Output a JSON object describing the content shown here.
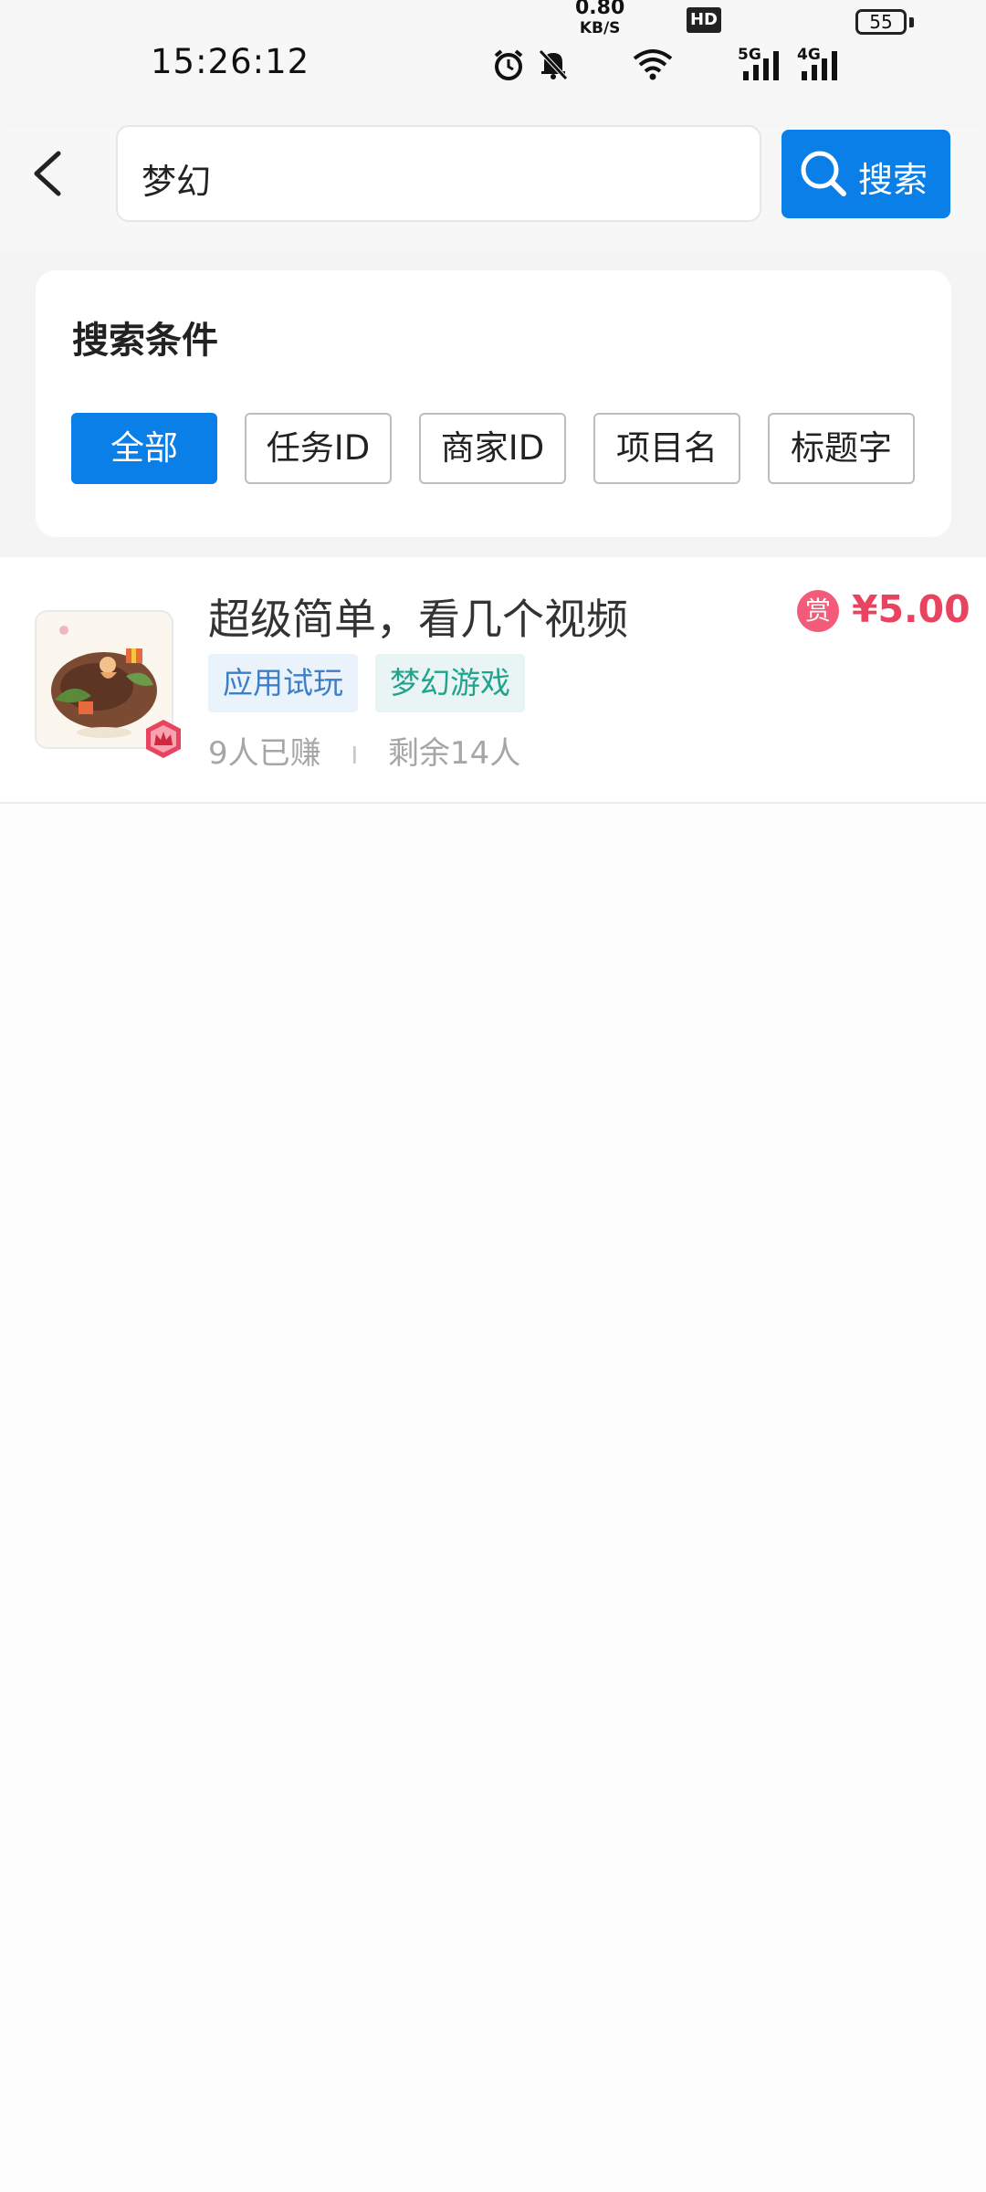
{
  "status_bar": {
    "time": "15:26:12",
    "net_speed_value": "0.80",
    "net_speed_unit": "KB/S",
    "hd_label": "HD",
    "signal1_label": "5G",
    "signal2_label": "4G",
    "battery": "55"
  },
  "header": {
    "search_value": "梦幻",
    "search_button_label": "搜索"
  },
  "conditions": {
    "title": "搜索条件",
    "chips": [
      "全部",
      "任务ID",
      "商家ID",
      "项目名",
      "标题字"
    ],
    "active_index": 0
  },
  "tasks": [
    {
      "title": "超级简单，看几个视频",
      "tags": [
        "应用试玩",
        "梦幻游戏"
      ],
      "earned": "9人已赚",
      "separator": "I",
      "remaining": "剩余14人",
      "reward_icon": "赏",
      "reward": "¥5.00"
    }
  ],
  "colors": {
    "accent": "#0a7fe8",
    "reward": "#e8435f",
    "tag_blue": "#3d7fc7",
    "tag_green": "#22a38d"
  }
}
